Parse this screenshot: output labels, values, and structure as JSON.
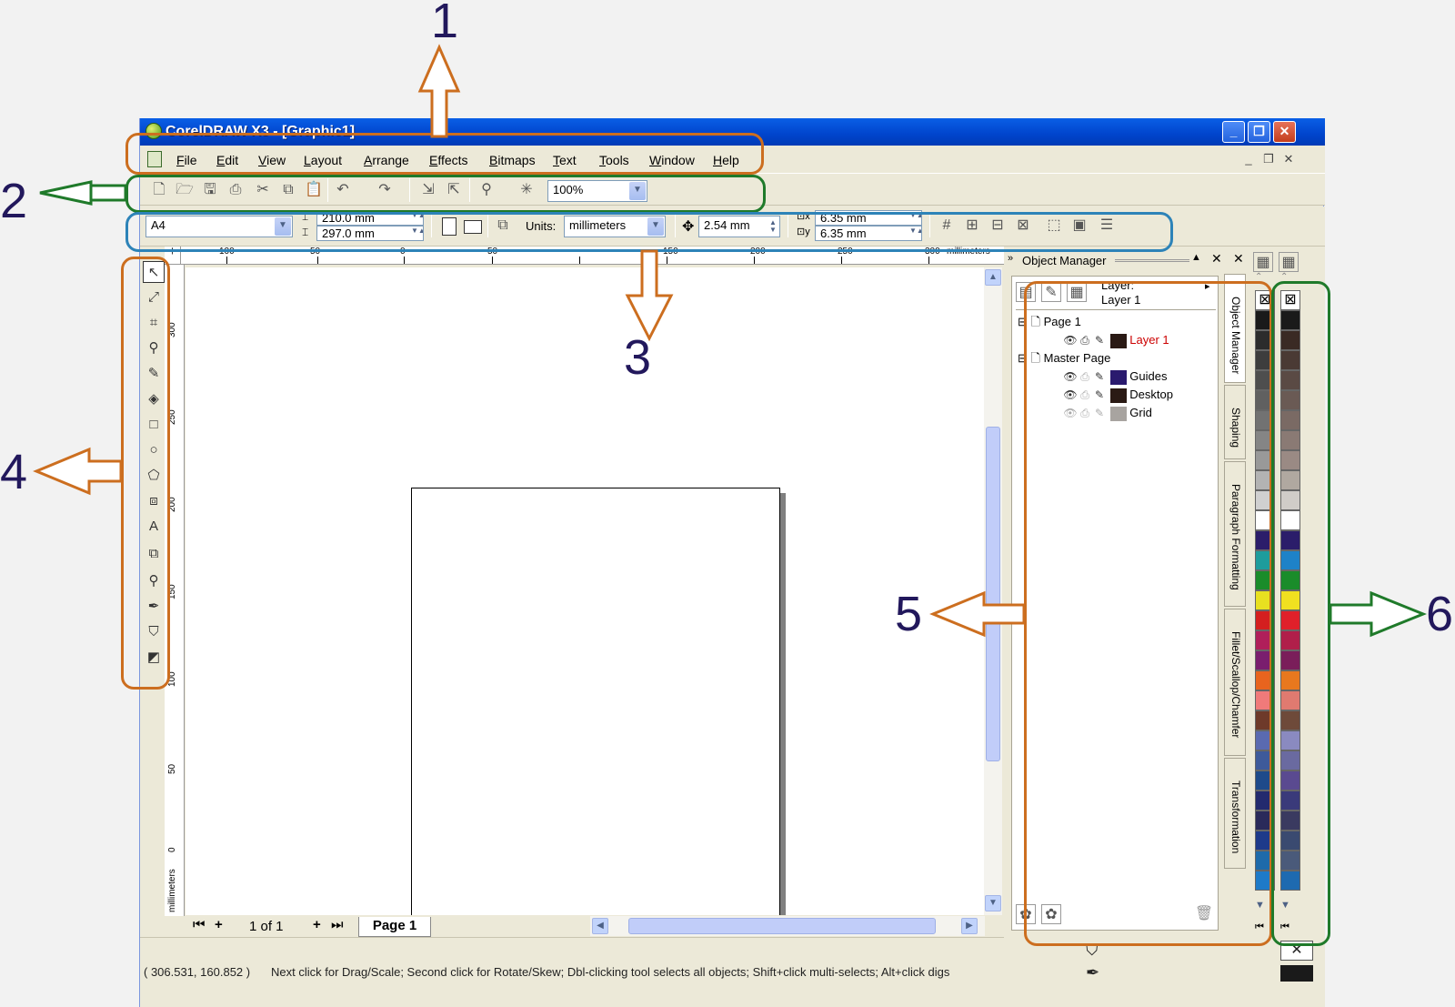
{
  "window": {
    "title": "CorelDRAW X3 - [Graphic1]",
    "buttons": {
      "minimize": "_",
      "restore": "❐",
      "close": "✕"
    }
  },
  "menu": [
    "File",
    "Edit",
    "View",
    "Layout",
    "Arrange",
    "Effects",
    "Bitmaps",
    "Text",
    "Tools",
    "Window",
    "Help"
  ],
  "standard_toolbar": {
    "icons": [
      "new-icon",
      "open-icon",
      "save-icon",
      "print-icon",
      "cut-icon",
      "copy-icon",
      "paste-icon",
      "undo-icon",
      "redo-icon",
      "import-icon",
      "export-icon",
      "app-launcher-icon",
      "corel-online-icon"
    ],
    "zoom": "100%"
  },
  "property_bar": {
    "paper_size": "A4",
    "width": "210.0 mm",
    "height": "297.0 mm",
    "units_label": "Units:",
    "units": "millimeters",
    "nudge": "2.54 mm",
    "dup_x": "6.35 mm",
    "dup_y": "6.35 mm"
  },
  "ruler": {
    "h_labels": [
      "100",
      "50",
      "0",
      "50",
      "150",
      "200",
      "250",
      "300",
      "millimeters"
    ],
    "v_labels": [
      "300",
      "250",
      "200",
      "150",
      "100",
      "50",
      "0",
      "millimeters"
    ]
  },
  "page_nav": {
    "count": "1 of 1",
    "tab": "Page 1"
  },
  "status": {
    "coords": "( 306.531, 160.852 )",
    "message": "Next click for Drag/Scale; Second click for Rotate/Skew; Dbl-clicking tool selects all objects; Shift+click multi-selects; Alt+click digs"
  },
  "object_manager": {
    "title": "Object Manager",
    "layer_label": "Layer:",
    "layer_name": "Layer 1",
    "tree": [
      {
        "label": "Page 1",
        "level": 0,
        "type": "page"
      },
      {
        "label": "Layer 1",
        "level": 1,
        "color": "#2a1a14",
        "text_color": "#cc0000"
      },
      {
        "label": "Master Page",
        "level": 0,
        "type": "page"
      },
      {
        "label": "Guides",
        "level": 1,
        "color": "#2a1a6e",
        "text_color": "#000000"
      },
      {
        "label": "Desktop",
        "level": 1,
        "color": "#2a1a14",
        "text_color": "#000000"
      },
      {
        "label": "Grid",
        "level": 1,
        "color": "#a8a4a0",
        "text_color": "#000000"
      }
    ],
    "tabs": [
      "Object Manager",
      "Shaping",
      "Paragraph Formatting",
      "Fillet/Scallop/Chamfer",
      "Transformation"
    ]
  },
  "palette": {
    "left": [
      "#1a1a1a",
      "#2c2c2c",
      "#3d3d3d",
      "#4e4e4e",
      "#606060",
      "#727272",
      "#858585",
      "#999999",
      "#b3b3b3",
      "#d0d0d0",
      "#ffffff",
      "#2b1d6a",
      "#1e9c9c",
      "#1a8c2a",
      "#e8e020",
      "#d41f1f",
      "#b01f5a",
      "#7a1e6e",
      "#e8641e",
      "#f07a7a",
      "#6e3a2a",
      "#5a6ab0",
      "#3e5a9a",
      "#1e4a8a",
      "#232a6e",
      "#2a2a5a",
      "#1e3a8a",
      "#1e6aaa",
      "#1e7ac8"
    ],
    "right": [
      "#1a1a1a",
      "#3a2a24",
      "#4a3a34",
      "#5a4a44",
      "#6a5a54",
      "#7a6a64",
      "#8a7a74",
      "#9a8a84",
      "#b0a8a0",
      "#d0ccc8",
      "#ffffff",
      "#2b1d6a",
      "#1e82c8",
      "#1a8c2a",
      "#f0e020",
      "#e0202a",
      "#b01f4a",
      "#7a1e5a",
      "#e8781e",
      "#e07a70",
      "#6e4a3a",
      "#8a8ac0",
      "#6a6aa0",
      "#5a4a90",
      "#3a3a7a",
      "#3a3a60",
      "#3a4a70",
      "#4a5a7a",
      "#1e6ab0"
    ]
  },
  "annotations": [
    "1",
    "2",
    "3",
    "4",
    "5",
    "6"
  ]
}
